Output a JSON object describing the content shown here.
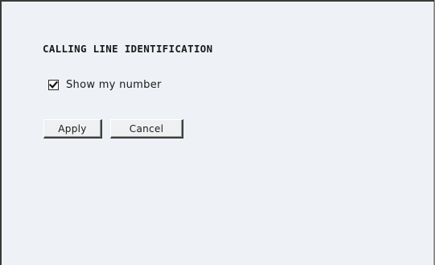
{
  "section": {
    "title": "CALLING LINE IDENTIFICATION"
  },
  "options": {
    "show_number": {
      "label": "Show my number",
      "checked": true
    }
  },
  "buttons": {
    "apply_label": "Apply",
    "cancel_label": "Cancel"
  },
  "icons": {
    "checkbox_mark": "checkmark-icon"
  },
  "colors": {
    "panel_background": "#eef2f6",
    "border": "#3a3a3a"
  }
}
